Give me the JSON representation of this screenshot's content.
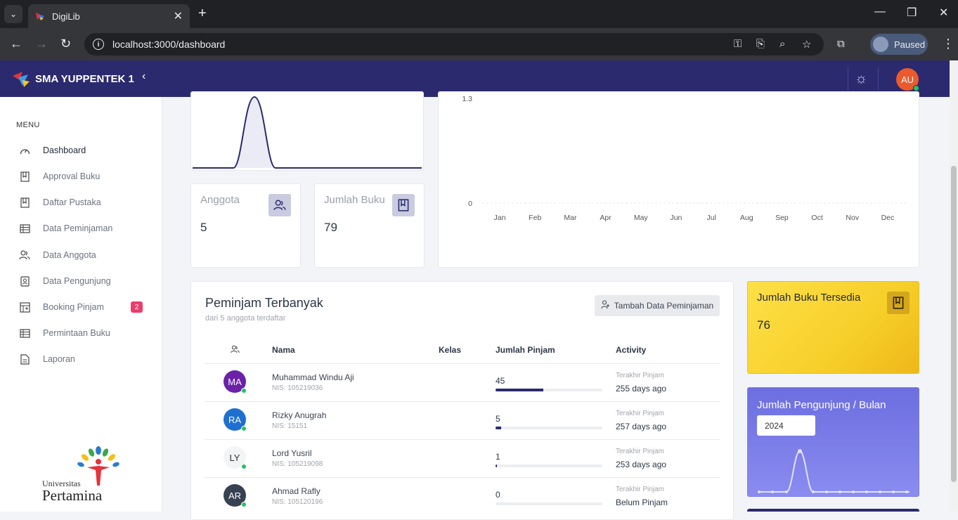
{
  "browser": {
    "tab_title": "DigiLib",
    "url": "localhost:3000/dashboard",
    "profile_status": "Paused"
  },
  "header": {
    "brand": "SMA YUPPENTEK 1",
    "avatar_initials": "AU"
  },
  "sidebar": {
    "menu_label": "MENU",
    "items": [
      {
        "label": "Dashboard",
        "icon": "gauge-icon"
      },
      {
        "label": "Approval Buku",
        "icon": "book-icon"
      },
      {
        "label": "Daftar Pustaka",
        "icon": "book-icon"
      },
      {
        "label": "Data Peminjaman",
        "icon": "list-icon"
      },
      {
        "label": "Data Anggota",
        "icon": "users-icon"
      },
      {
        "label": "Data Pengunjung",
        "icon": "id-card-icon"
      },
      {
        "label": "Booking Pinjam",
        "icon": "booking-icon",
        "badge": "2"
      },
      {
        "label": "Permintaan Buku",
        "icon": "list-icon"
      },
      {
        "label": "Laporan",
        "icon": "document-icon"
      }
    ],
    "logo_top": "Universitas",
    "logo_bottom": "Pertamina"
  },
  "stats": {
    "anggota_label": "Anggota",
    "anggota_value": "5",
    "buku_label": "Jumlah Buku",
    "buku_value": "79"
  },
  "chart_data": {
    "type": "line",
    "categories": [
      "Jan",
      "Feb",
      "Mar",
      "Apr",
      "May",
      "Jun",
      "Jul",
      "Aug",
      "Sep",
      "Oct",
      "Nov",
      "Dec"
    ],
    "y_ticks": [
      "1.3",
      "0"
    ],
    "values": [
      0,
      0,
      0,
      0,
      0,
      0,
      0,
      0,
      0,
      0,
      0,
      0
    ],
    "ylim": [
      0,
      1.3
    ]
  },
  "peminjam": {
    "title": "Peminjam Terbanyak",
    "subtitle": "dari 5 anggota terdaftar",
    "add_button": "Tambah Data Peminjaman",
    "columns": {
      "nama": "Nama",
      "kelas": "Kelas",
      "jumlah": "Jumlah Pinjam",
      "activity": "Activity"
    },
    "rows": [
      {
        "initials": "MA",
        "color": "#6b21a8",
        "name": "Muhammad Windu Aji",
        "nis": "NIS: 105219036",
        "count": "45",
        "progress": 0.45,
        "act_label": "Terakhir Pinjam",
        "act_value": "255 days ago"
      },
      {
        "initials": "RA",
        "color": "#1e6fd0",
        "name": "Rizky Anugrah",
        "nis": "NIS: 15151",
        "count": "5",
        "progress": 0.05,
        "act_label": "Terakhir Pinjam",
        "act_value": "257 days ago"
      },
      {
        "initials": "LY",
        "color": "#f3f4f6",
        "name": "Lord Yusril",
        "nis": "NIS: 105219098",
        "count": "1",
        "progress": 0.01,
        "act_label": "Terakhir Pinjam",
        "act_value": "253 days ago"
      },
      {
        "initials": "AR",
        "color": "#374151",
        "name": "Ahmad Rafly",
        "nis": "NIS: 105120196",
        "count": "0",
        "progress": 0,
        "act_label": "Terakhir Pinjam",
        "act_value": "Belum Pinjam"
      }
    ]
  },
  "tersedia": {
    "label": "Jumlah Buku Tersedia",
    "value": "76"
  },
  "pengunjung": {
    "label": "Jumlah Pengunjung / Bulan",
    "year": "2024"
  }
}
